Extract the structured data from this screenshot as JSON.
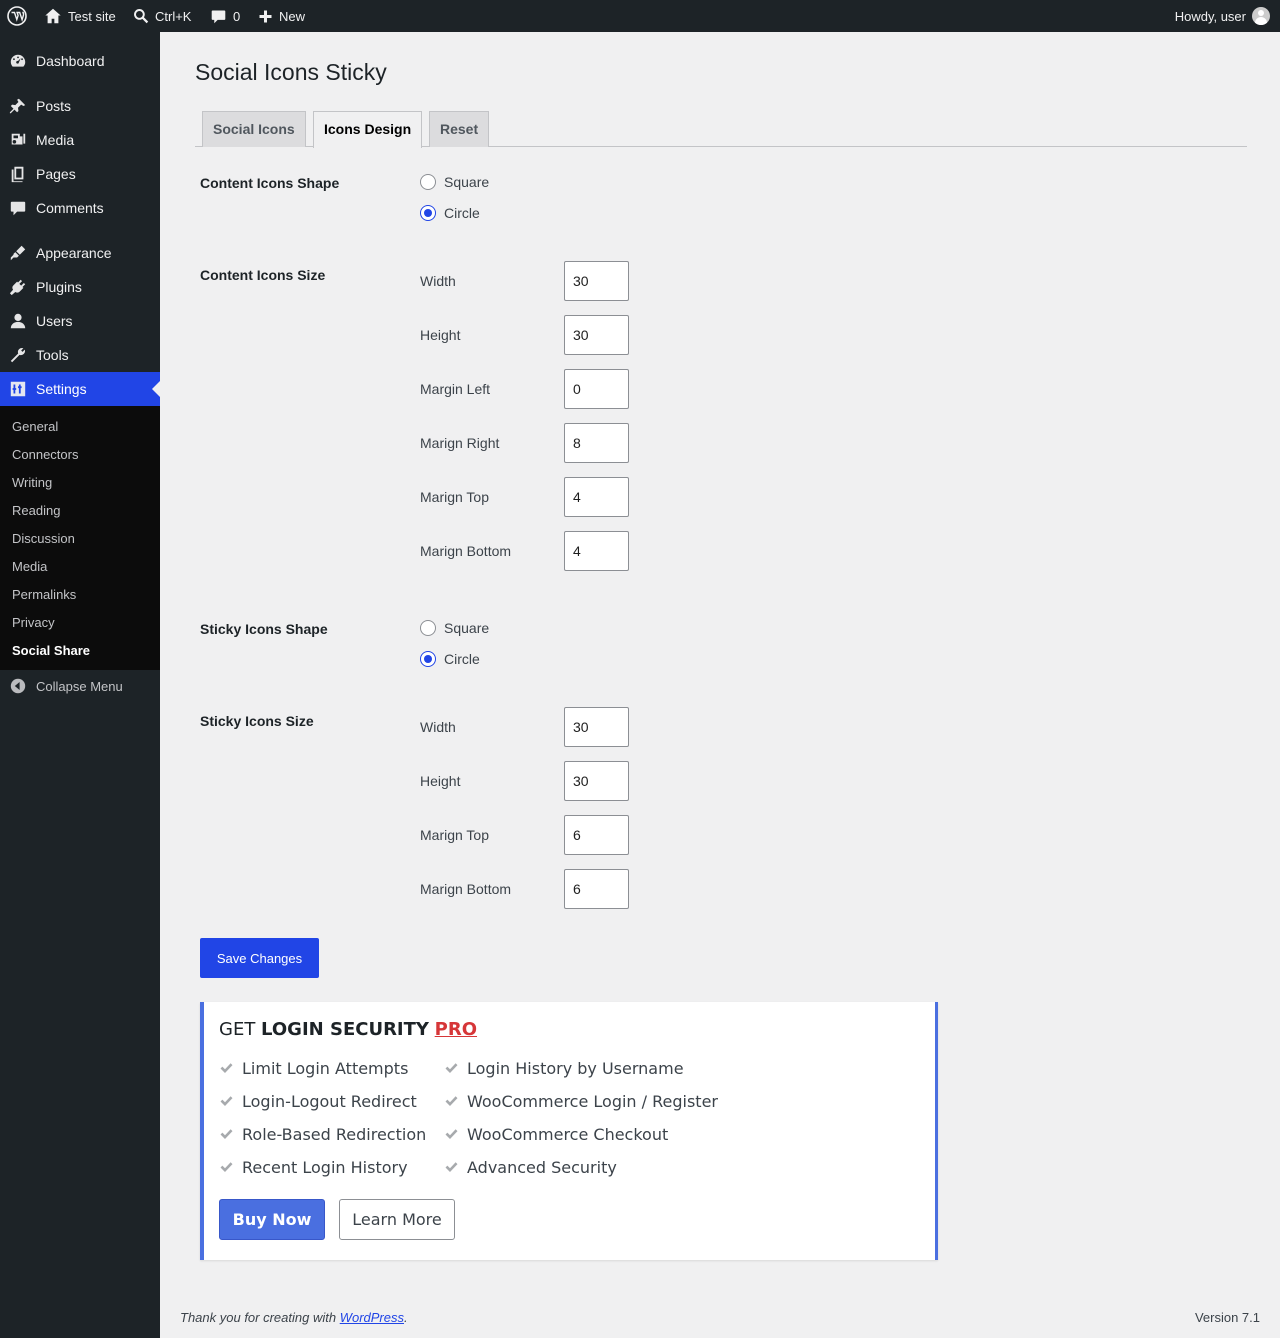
{
  "adminbar": {
    "site_name": "Test site",
    "search_shortcut": "Ctrl+K",
    "comments_count": "0",
    "new_label": "New",
    "greeting": "Howdy, user"
  },
  "sidebar": {
    "items": [
      {
        "label": "Dashboard",
        "icon": "dashboard-icon"
      },
      {
        "label": "Posts",
        "icon": "pin-icon"
      },
      {
        "label": "Media",
        "icon": "media-icon"
      },
      {
        "label": "Pages",
        "icon": "pages-icon"
      },
      {
        "label": "Comments",
        "icon": "comment-icon"
      },
      {
        "label": "Appearance",
        "icon": "brush-icon"
      },
      {
        "label": "Plugins",
        "icon": "plugin-icon"
      },
      {
        "label": "Users",
        "icon": "user-icon"
      },
      {
        "label": "Tools",
        "icon": "wrench-icon"
      },
      {
        "label": "Settings",
        "icon": "settings-icon"
      }
    ],
    "submenu": [
      "General",
      "Connectors",
      "Writing",
      "Reading",
      "Discussion",
      "Media",
      "Permalinks",
      "Privacy",
      "Social Share"
    ],
    "collapse_label": "Collapse Menu"
  },
  "page": {
    "title": "Social Icons Sticky",
    "tabs": [
      "Social Icons",
      "Icons Design",
      "Reset"
    ],
    "active_tab": "Icons Design"
  },
  "content_shape": {
    "label": "Content Icons Shape",
    "options": [
      "Square",
      "Circle"
    ],
    "selected": "Circle"
  },
  "content_size": {
    "label": "Content Icons Size",
    "fields": [
      {
        "label": "Width",
        "value": "30"
      },
      {
        "label": "Height",
        "value": "30"
      },
      {
        "label": "Margin Left",
        "value": "0"
      },
      {
        "label": "Marign Right",
        "value": "8"
      },
      {
        "label": "Marign Top",
        "value": "4"
      },
      {
        "label": "Marign Bottom",
        "value": "4"
      }
    ]
  },
  "sticky_shape": {
    "label": "Sticky Icons Shape",
    "options": [
      "Square",
      "Circle"
    ],
    "selected": "Circle"
  },
  "sticky_size": {
    "label": "Sticky Icons Size",
    "fields": [
      {
        "label": "Width",
        "value": "30"
      },
      {
        "label": "Height",
        "value": "30"
      },
      {
        "label": "Marign Top",
        "value": "6"
      },
      {
        "label": "Marign Bottom",
        "value": "6"
      }
    ]
  },
  "save_label": "Save Changes",
  "promo": {
    "title_prefix": "GET ",
    "title_bold": "LOGIN SECURITY",
    "title_pro": "PRO",
    "features_left": [
      "Limit Login Attempts",
      "Login-Logout Redirect",
      "Role-Based Redirection",
      "Recent Login History"
    ],
    "features_right": [
      "Login History by Username",
      "WooCommerce Login / Register",
      "WooCommerce Checkout",
      "Advanced Security"
    ],
    "buy_label": "Buy Now",
    "learn_label": "Learn More"
  },
  "footer": {
    "thanks_prefix": "Thank you for creating with ",
    "thanks_link": "WordPress",
    "thanks_suffix": ".",
    "version": "Version 7.1"
  },
  "colors": {
    "accent": "#2145e6",
    "promo_accent": "#4a6fe0",
    "pro_red": "#d63638",
    "sidebar_bg": "#1d2327"
  }
}
